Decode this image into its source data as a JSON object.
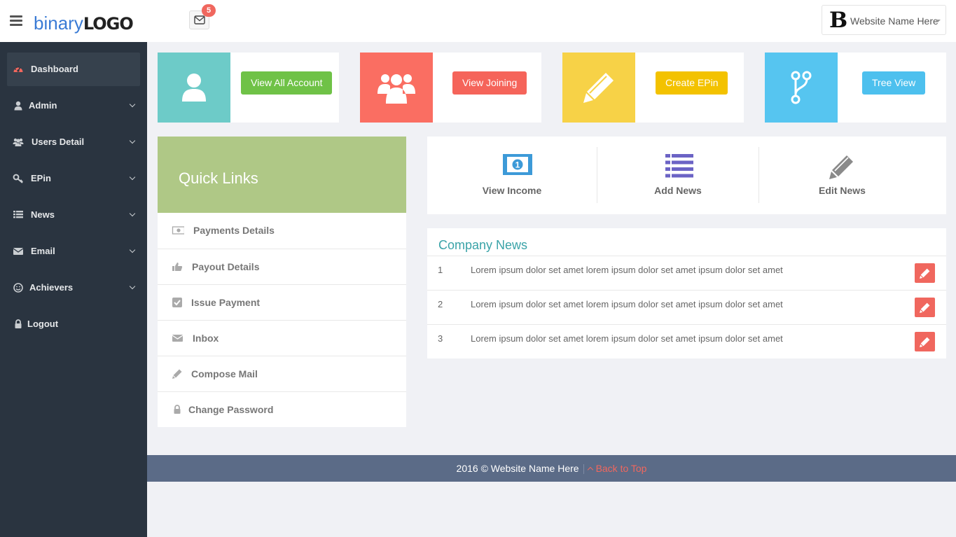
{
  "header": {
    "logo_part1": "binary",
    "logo_part2": "LOGO",
    "mail_count": "5",
    "site_logo_letter": "B",
    "site_name": "Website Name Here"
  },
  "sidebar": {
    "items": [
      {
        "label": "Dashboard",
        "icon": "dashboard-icon",
        "active": true
      },
      {
        "label": "Admin",
        "icon": "user-icon"
      },
      {
        "label": "Users Detail",
        "icon": "users-icon"
      },
      {
        "label": "EPin",
        "icon": "key-icon"
      },
      {
        "label": "News",
        "icon": "list-icon"
      },
      {
        "label": "Email",
        "icon": "envelope-icon"
      },
      {
        "label": "Achievers",
        "icon": "smile-icon"
      },
      {
        "label": "Logout",
        "icon": "lock-icon"
      }
    ]
  },
  "tiles": [
    {
      "button": "View All Account",
      "icon": "user-icon",
      "color": "#6dcbc8",
      "button_color": "#6fc247"
    },
    {
      "button": "View Joining",
      "icon": "users-icon",
      "color": "#fa6e62",
      "button_color": "#f5645a"
    },
    {
      "button": "Create EPin",
      "icon": "pencil-icon",
      "color": "#f7d247",
      "button_color": "#f3c200"
    },
    {
      "button": "Tree View",
      "icon": "fork-icon",
      "color": "#56c5f0",
      "button_color": "#4dc0ee"
    }
  ],
  "quick_links": {
    "title": "Quick Links",
    "items": [
      {
        "label": "Payments Details",
        "icon": "money-icon"
      },
      {
        "label": "Payout Details",
        "icon": "thumbs-up-icon"
      },
      {
        "label": "Issue Payment",
        "icon": "check-square-icon"
      },
      {
        "label": "Inbox",
        "icon": "envelope-icon"
      },
      {
        "label": "Compose Mail",
        "icon": "pencil-icon"
      },
      {
        "label": "Change Password",
        "icon": "lock-icon"
      }
    ]
  },
  "actions": [
    {
      "label": "View Income",
      "icon": "money-icon"
    },
    {
      "label": "Add News",
      "icon": "list-icon"
    },
    {
      "label": "Edit News",
      "icon": "pencil-icon"
    }
  ],
  "news": {
    "title": "Company News",
    "rows": [
      {
        "num": "1",
        "text": "Lorem ipsum dolor set amet lorem ipsum dolor set amet ipsum dolor set amet"
      },
      {
        "num": "2",
        "text": "Lorem ipsum dolor set amet lorem ipsum dolor set amet ipsum dolor set amet"
      },
      {
        "num": "3",
        "text": "Lorem ipsum dolor set amet lorem ipsum dolor set amet ipsum dolor set amet"
      }
    ]
  },
  "footer": {
    "copyright": "2016 © Website Name Here",
    "back_to_top": "Back to Top"
  },
  "colors": {
    "sidebar_bg": "#2a3440",
    "quick_links_header": "#afc886",
    "news_title": "#3aa3a8",
    "footer_bg": "#5b6b87",
    "accent_red": "#f0675e"
  }
}
